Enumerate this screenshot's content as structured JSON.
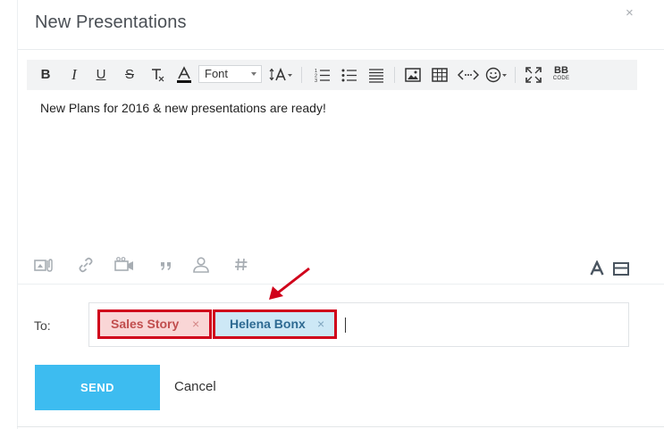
{
  "dialog": {
    "title": "New Presentations",
    "close_glyph": "×"
  },
  "toolbar": {
    "bold": "B",
    "italic": "I",
    "underline": "U",
    "strike": "S",
    "clear_format": "T",
    "font_select": "Font",
    "buttons": [
      "bold",
      "italic",
      "underline",
      "strikethrough",
      "clear-format",
      "font-color",
      "font-family",
      "font-size",
      "ordered-list",
      "unordered-list",
      "align",
      "image",
      "table",
      "code",
      "emoji",
      "fullscreen",
      "bbcode"
    ],
    "bbcode_top": "BB",
    "bbcode_bottom": "CODE"
  },
  "editor": {
    "content": "New Plans for 2016 & new presentations are ready!"
  },
  "attachment_icons": [
    "attach-icon",
    "link-icon",
    "video-icon",
    "quote-icon",
    "mention-icon",
    "hashtag-icon",
    "text-format-icon",
    "panel-icon"
  ],
  "recipients": {
    "label": "To:",
    "tags": [
      {
        "label": "Sales Story",
        "remove": "×",
        "color": "#f9d6d6"
      },
      {
        "label": "Helena Bonx",
        "remove": "×",
        "color": "#cde8f6"
      }
    ],
    "highlight_color": "#d0021b"
  },
  "actions": {
    "send": "SEND",
    "cancel": "Cancel",
    "send_color": "#3dbcf0"
  },
  "annotation": {
    "arrow_color": "#d0021b"
  }
}
